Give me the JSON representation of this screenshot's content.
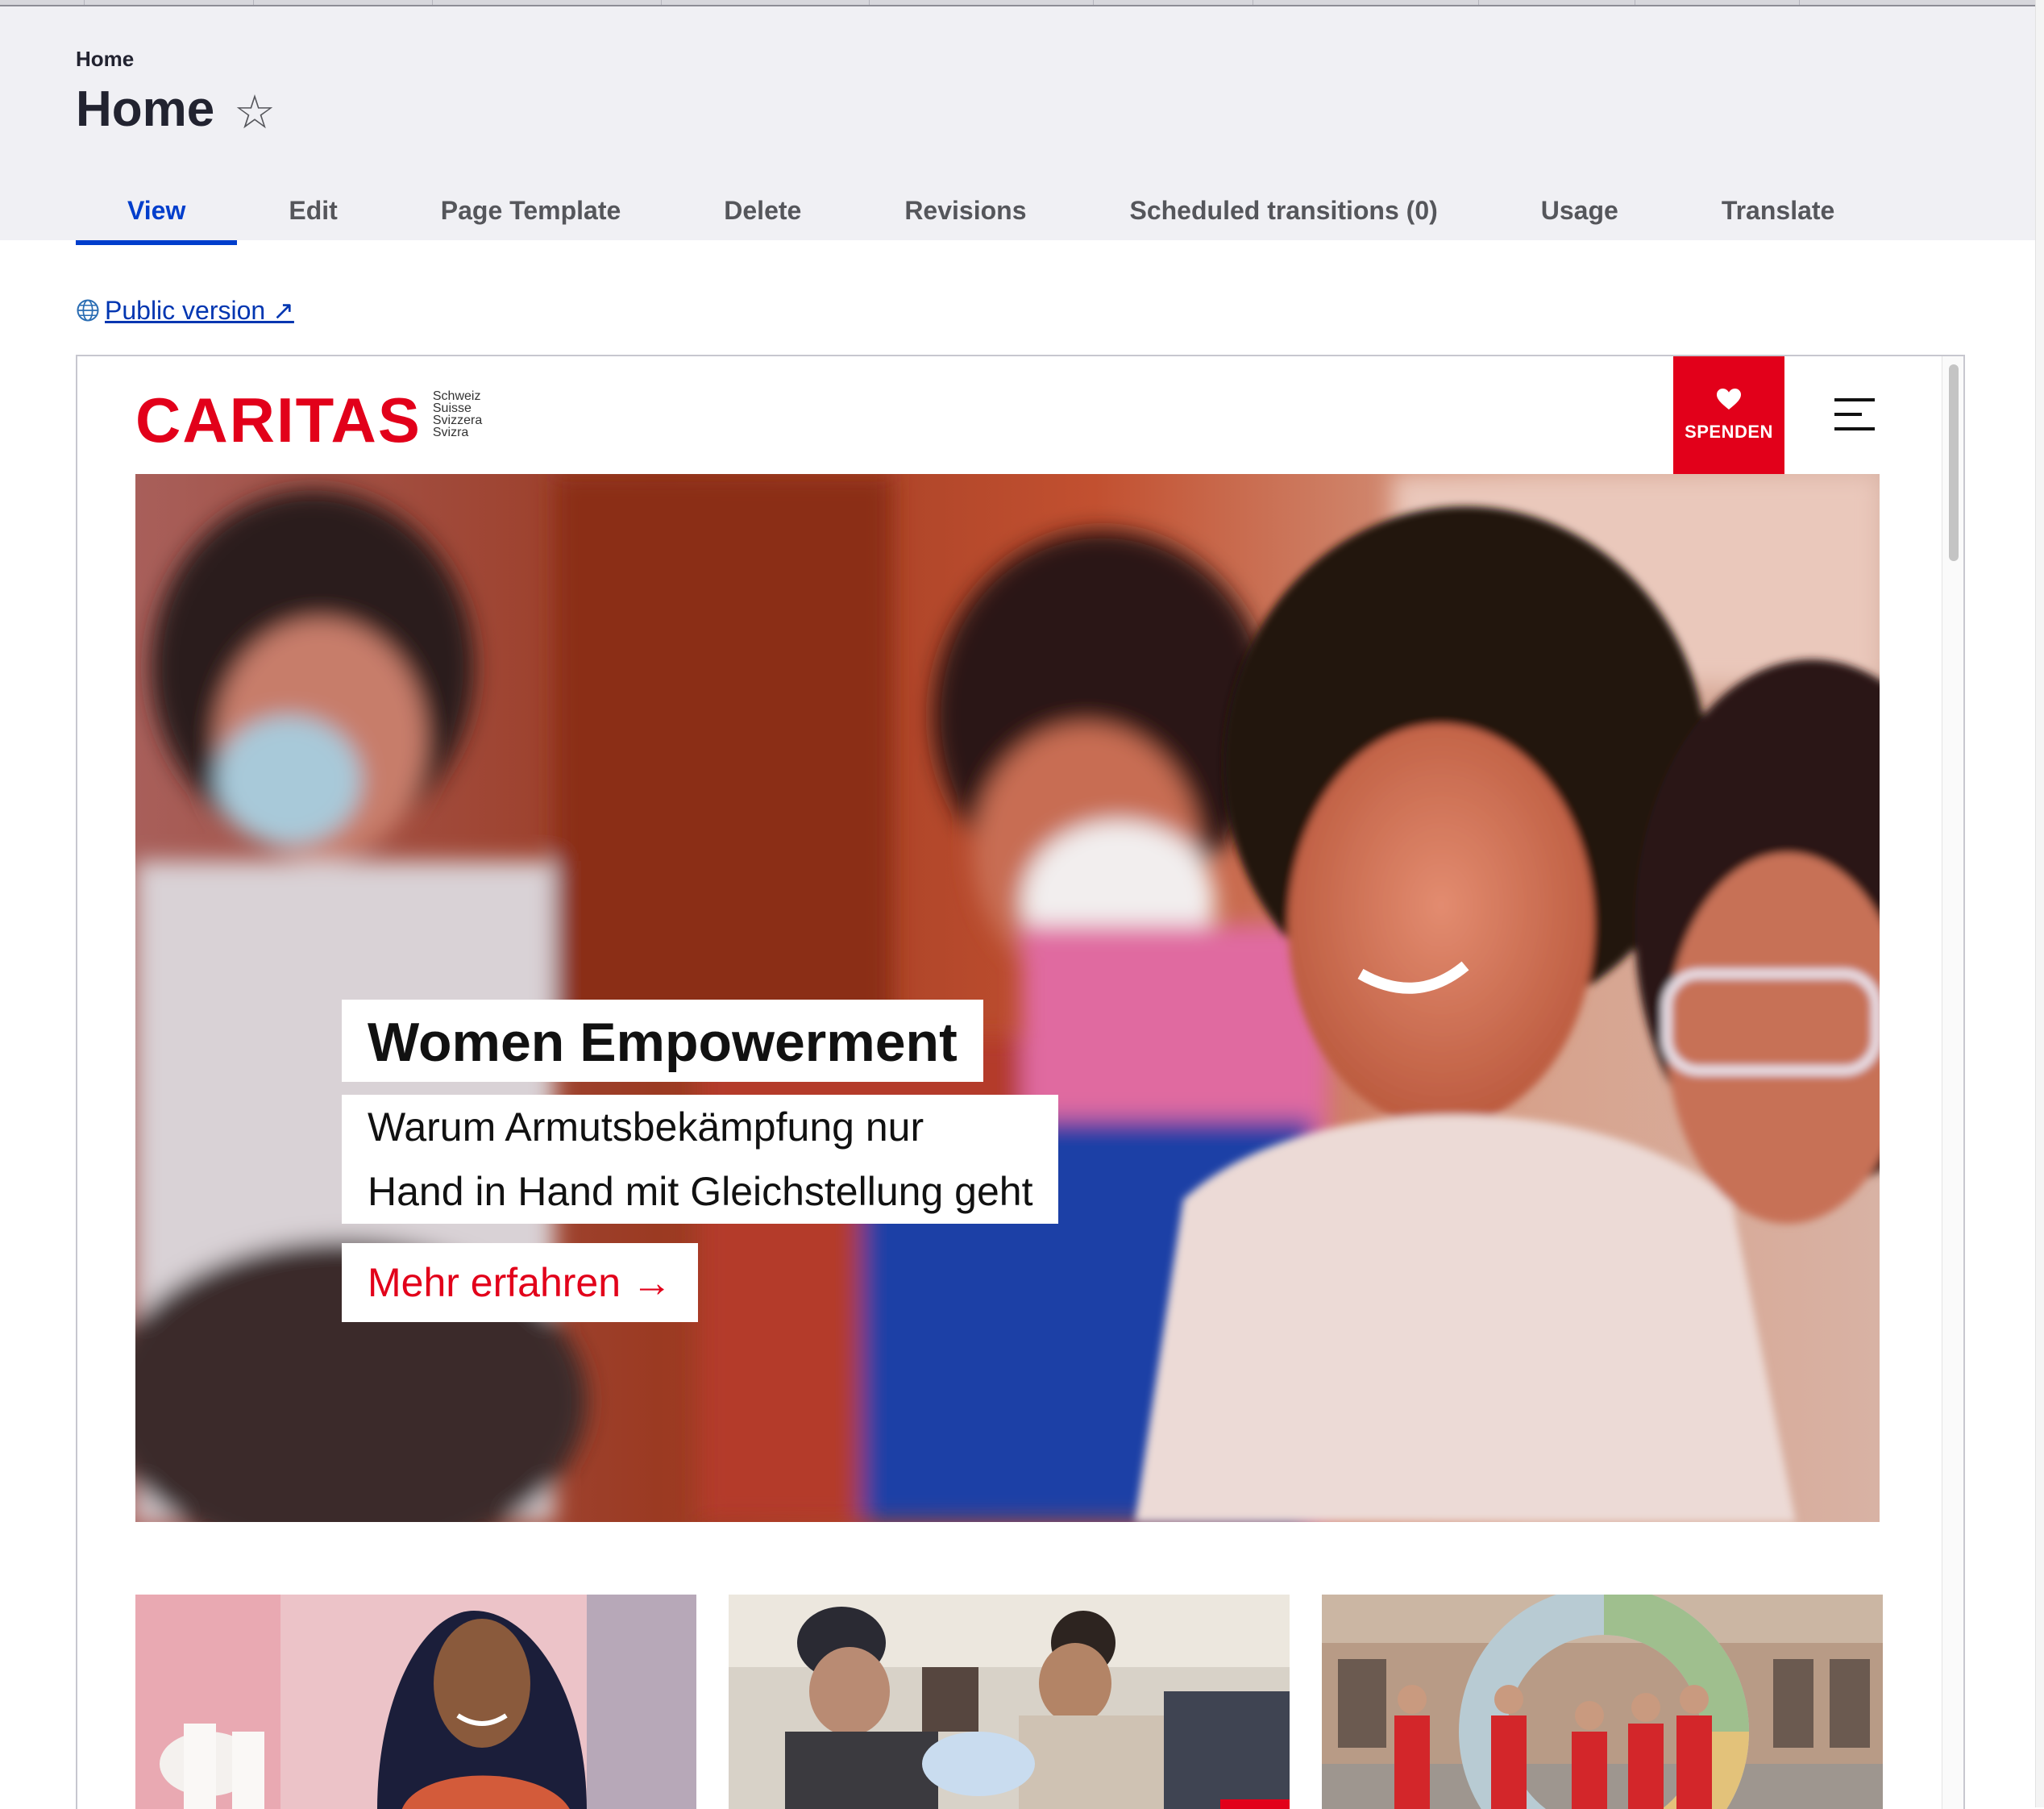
{
  "header": {
    "breadcrumb": "Home",
    "title": "Home",
    "favorite_icon": "star-outline-icon",
    "tabs": [
      {
        "label": "View",
        "active": true
      },
      {
        "label": "Edit"
      },
      {
        "label": "Page Template"
      },
      {
        "label": "Delete"
      },
      {
        "label": "Revisions"
      },
      {
        "label": "Scheduled transitions (0)"
      },
      {
        "label": "Usage"
      },
      {
        "label": "Translate"
      }
    ]
  },
  "public_link": {
    "label": "Public version ↗",
    "icon": "globe-icon"
  },
  "site": {
    "logo_word": "CARITAS",
    "logo_languages": [
      "Schweiz",
      "Suisse",
      "Svizzera",
      "Svizra"
    ],
    "donate_label": "SPENDEN",
    "donate_icon": "heart-icon",
    "menu_icon": "hamburger-menu-icon",
    "brand_color": "#e2001a"
  },
  "hero": {
    "title": "Women Empowerment",
    "subtitle_lines": [
      "Warum Armutsbekämpfung nur",
      "Hand in Hand mit Gleichstellung geht"
    ],
    "cta": "Mehr erfahren →"
  },
  "colors": {
    "admin_accent": "#003ecc",
    "header_bg": "#f0f0f4"
  }
}
